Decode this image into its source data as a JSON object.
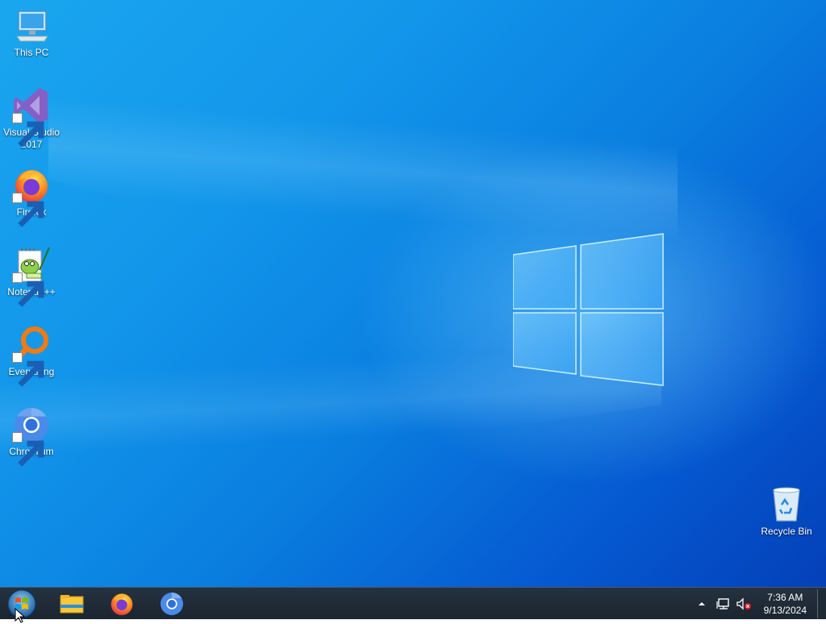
{
  "desktop": {
    "icons": [
      {
        "label_line1": "This PC",
        "label_line2": "",
        "icon": "computer-icon"
      },
      {
        "label_line1": "Visual Studio",
        "label_line2": "2017",
        "icon": "visual-studio-icon"
      },
      {
        "label_line1": "Firefox",
        "label_line2": "",
        "icon": "firefox-icon"
      },
      {
        "label_line1": "Notepad++",
        "label_line2": "",
        "icon": "notepad-plus-plus-icon"
      },
      {
        "label_line1": "Everything",
        "label_line2": "",
        "icon": "everything-search-icon"
      },
      {
        "label_line1": "Chromium",
        "label_line2": "",
        "icon": "chromium-icon"
      }
    ],
    "recycle_bin": {
      "label": "Recycle Bin",
      "icon": "recycle-bin-icon"
    }
  },
  "taskbar": {
    "start_icon": "windows-orb-icon",
    "pinned": [
      {
        "name": "File Explorer",
        "icon": "file-explorer-icon"
      },
      {
        "name": "Firefox",
        "icon": "firefox-icon"
      },
      {
        "name": "Chromium",
        "icon": "chromium-icon"
      }
    ],
    "tray": {
      "time": "7:36 AM",
      "date": "9/13/2024",
      "icons": [
        "show-hidden-icons-chevron",
        "network-icon",
        "volume-muted-icon"
      ]
    }
  },
  "colors": {
    "desktop_accent": "#0a7fe0",
    "taskbar_bg": "#1f2b37",
    "label_text": "#ffffff"
  }
}
